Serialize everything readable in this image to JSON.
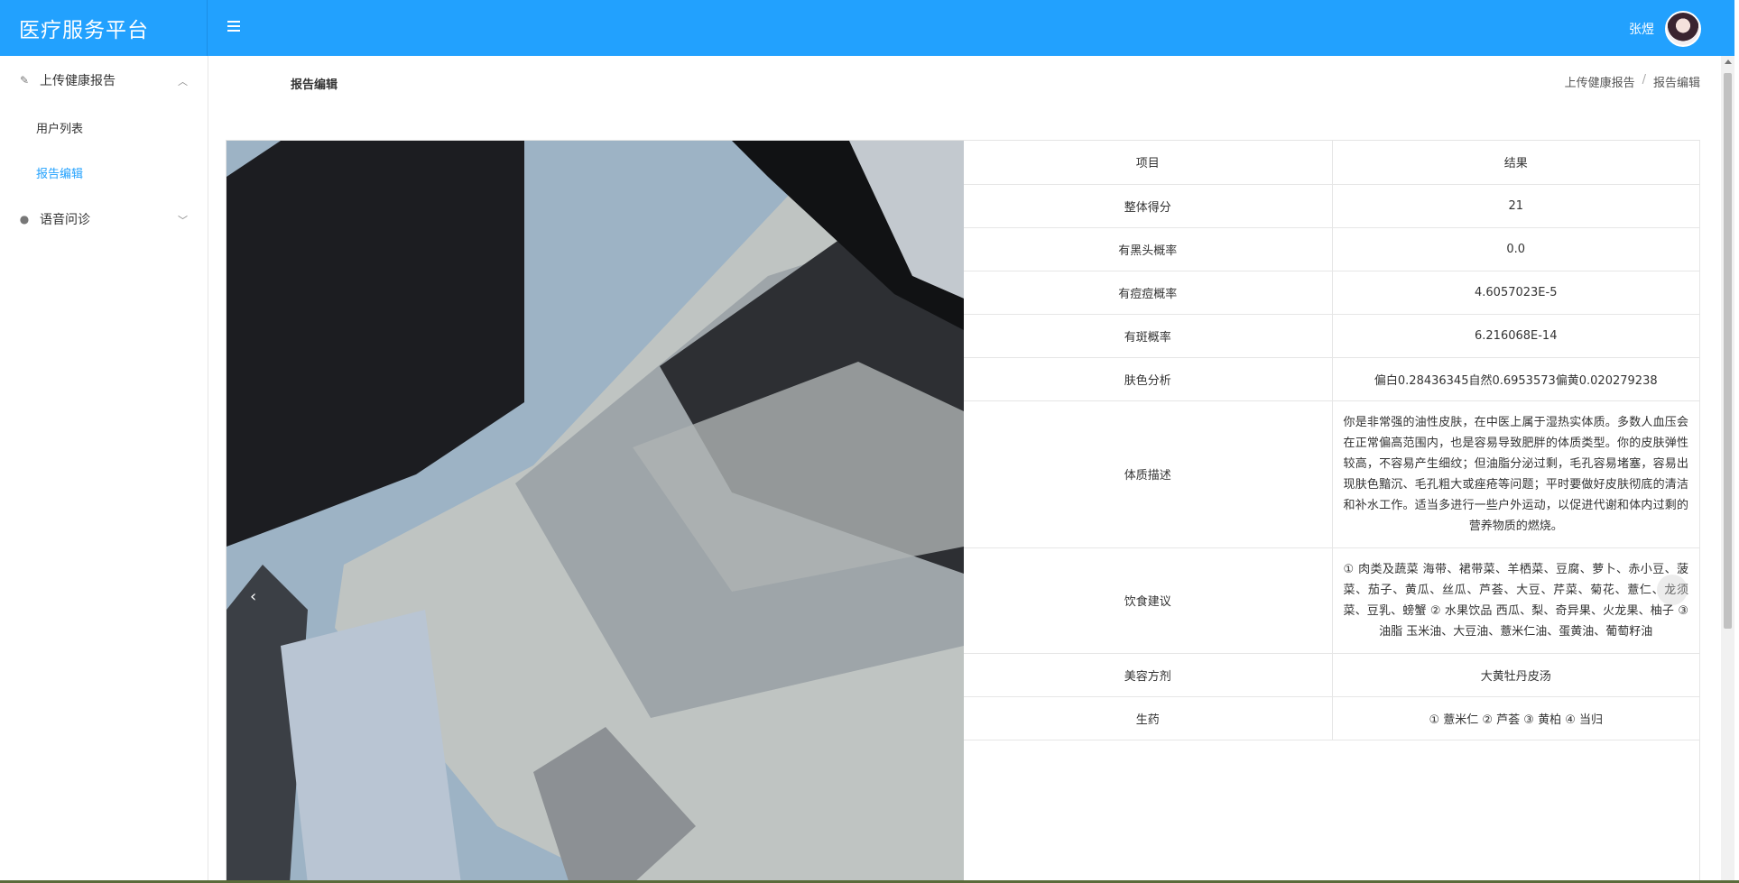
{
  "app": {
    "title": "医疗服务平台"
  },
  "header": {
    "user_name": "张煜"
  },
  "sidebar": {
    "groups": [
      {
        "label": "上传健康报告",
        "icon": "edit-icon",
        "expanded": true,
        "items": [
          {
            "label": "用户列表",
            "active": false
          },
          {
            "label": "报告编辑",
            "active": true
          }
        ]
      },
      {
        "label": "语音问诊",
        "icon": "comments-icon",
        "expanded": false
      }
    ]
  },
  "page": {
    "title": "报告编辑",
    "breadcrumb": [
      "上传健康报告",
      "报告编辑"
    ]
  },
  "table": {
    "headers": [
      "项目",
      "结果"
    ],
    "rows": [
      {
        "item": "整体得分",
        "value": "21"
      },
      {
        "item": "有黑头概率",
        "value": "0.0"
      },
      {
        "item": "有痘痘概率",
        "value": "4.6057023E-5"
      },
      {
        "item": "有斑概率",
        "value": "6.216068E-14"
      },
      {
        "item": "肤色分析",
        "value": "偏白0.28436345自然0.6953573偏黄0.020279238"
      },
      {
        "item": "体质描述",
        "value": "你是非常强的油性皮肤，在中医上属于湿热实体质。多数人血压会在正常偏高范围内，也是容易导致肥胖的体质类型。你的皮肤弹性较高，不容易产生细纹；但油脂分泌过剩，毛孔容易堵塞，容易出现肤色黯沉、毛孔粗大或痤疮等问题；平时要做好皮肤彻底的清洁和补水工作。适当多进行一些户外运动，以促进代谢和体内过剩的营养物质的燃烧。"
      },
      {
        "item": "饮食建议",
        "value": "① 肉类及蔬菜 海带、裙带菜、羊栖菜、豆腐、萝卜、赤小豆、菠菜、茄子、黄瓜、丝瓜、芦荟、大豆、芹菜、菊花、薏仁、龙须菜、豆乳、螃蟹 ② 水果饮品 西瓜、梨、奇异果、火龙果、柚子 ③ 油脂 玉米油、大豆油、薏米仁油、蛋黄油、葡萄籽油"
      },
      {
        "item": "美容方剂",
        "value": "大黄牡丹皮汤"
      },
      {
        "item": "生药",
        "value": "① 薏米仁 ② 芦荟 ③ 黄柏 ④ 当归"
      }
    ]
  },
  "carousel": {
    "prev_icon": "chevron-left-icon"
  },
  "colors": {
    "primary": "#22a1fe",
    "active_link": "#22a1fe"
  }
}
